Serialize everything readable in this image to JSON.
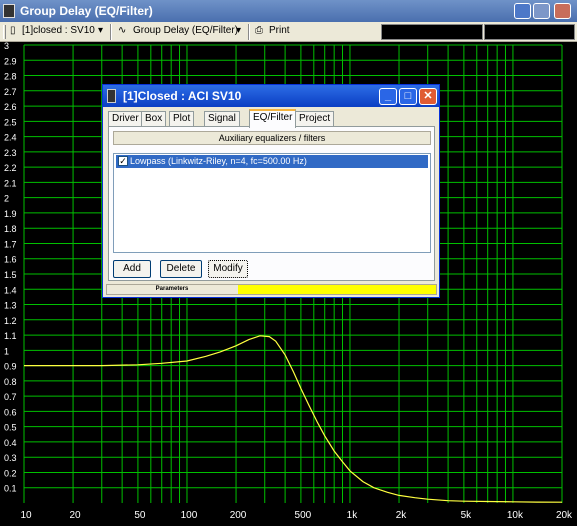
{
  "window": {
    "title": "Group Delay (EQ/Filter)"
  },
  "toolbar": {
    "project_selector": "[1]closed : SV10",
    "plot_selector": "Group Delay (EQ/Filter)",
    "print_label": "Print"
  },
  "dialog": {
    "title": "[1]Closed : ACI SV10",
    "tabs": [
      "Driver",
      "Box",
      "Plot",
      "Signal",
      "EQ/Filter",
      "Project"
    ],
    "active_tab": "EQ/Filter",
    "section_header": "Auxiliary equalizers / filters",
    "filters": [
      {
        "label": "Lowpass (Linkwitz-Riley, n=4, fc=500.00 Hz)",
        "checked": true,
        "selected": true
      }
    ],
    "buttons": {
      "add": "Add",
      "delete": "Delete",
      "modify": "Modify"
    },
    "status_label": "Parameters",
    "status_color": "#ffff00"
  },
  "chart_data": {
    "type": "line",
    "title": "",
    "xlabel": "",
    "ylabel": "",
    "x_scale": "log",
    "xlim": [
      10,
      20000
    ],
    "ylim": [
      0,
      3
    ],
    "y_ticks": [
      "3",
      "2.9",
      "2.8",
      "2.7",
      "2.6",
      "2.5",
      "2.4",
      "2.3",
      "2.2",
      "2.1",
      "2",
      "1.9",
      "1.8",
      "1.7",
      "1.6",
      "1.5",
      "1.4",
      "1.3",
      "1.2",
      "1.1",
      "1",
      "0.9",
      "0.8",
      "0.7",
      "0.6",
      "0.5",
      "0.4",
      "0.3",
      "0.2",
      "0.1"
    ],
    "x_ticks": [
      "10",
      "20",
      "50",
      "100",
      "200",
      "500",
      "1k",
      "2k",
      "5k",
      "10k",
      "20k"
    ],
    "grid": true,
    "grid_color": "#00c000",
    "line_color": "#ffff40",
    "background": "#000000",
    "series": [
      {
        "x": [
          10,
          20,
          30,
          50,
          70,
          100,
          130,
          160,
          200,
          240,
          280,
          320,
          350,
          400,
          450,
          500,
          560,
          630,
          700,
          800,
          900,
          1000,
          1200,
          1400,
          1700,
          2000,
          2500,
          3000,
          4000,
          5000,
          7000,
          10000,
          14000,
          20000
        ],
        "y": [
          0.9,
          0.9,
          0.9,
          0.905,
          0.915,
          0.93,
          0.96,
          0.99,
          1.03,
          1.07,
          1.095,
          1.09,
          1.06,
          0.97,
          0.86,
          0.75,
          0.64,
          0.53,
          0.44,
          0.34,
          0.27,
          0.21,
          0.14,
          0.1,
          0.07,
          0.05,
          0.035,
          0.025,
          0.015,
          0.012,
          0.01,
          0.008,
          0.006,
          0.005
        ]
      }
    ]
  }
}
